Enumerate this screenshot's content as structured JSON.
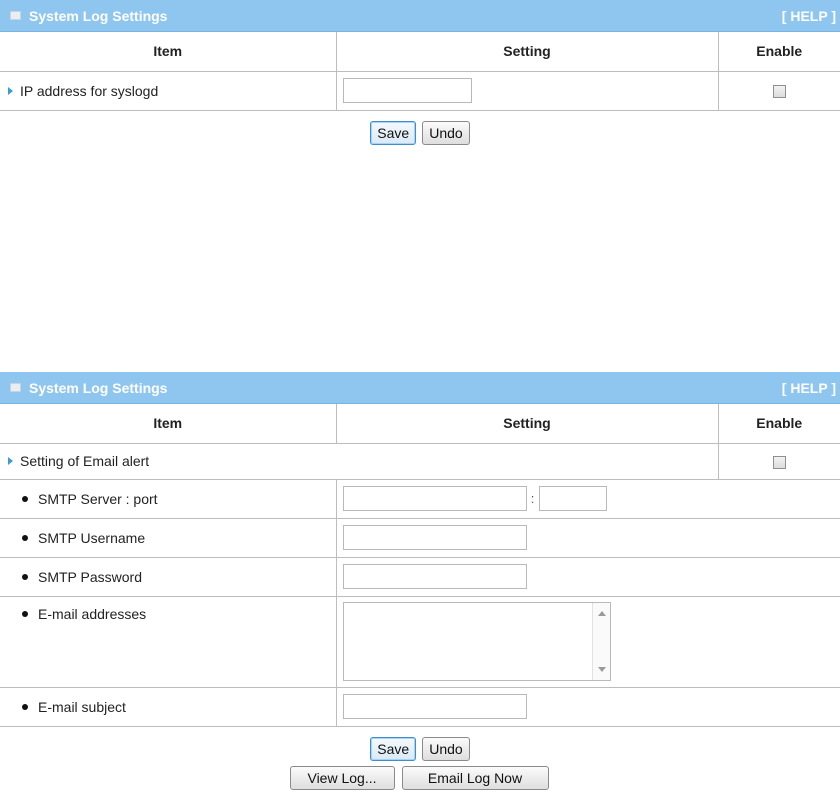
{
  "panel1": {
    "title": "System Log Settings",
    "help": "[ HELP ]",
    "columns": {
      "item": "Item",
      "setting": "Setting",
      "enable": "Enable"
    },
    "rows": [
      {
        "label": "IP address for syslogd",
        "value": "",
        "enabled": false
      }
    ],
    "buttons": {
      "save": "Save",
      "undo": "Undo"
    }
  },
  "panel2": {
    "title": "System Log Settings",
    "help": "[ HELP ]",
    "columns": {
      "item": "Item",
      "setting": "Setting",
      "enable": "Enable"
    },
    "email_alert": {
      "label": "Setting of Email alert",
      "enabled": false
    },
    "fields": {
      "smtp_server": {
        "label": "SMTP Server : port",
        "value": "",
        "port": "",
        "separator": ":"
      },
      "smtp_username": {
        "label": "SMTP Username",
        "value": ""
      },
      "smtp_password": {
        "label": "SMTP Password",
        "value": ""
      },
      "email_addresses": {
        "label": "E-mail addresses",
        "value": ""
      },
      "email_subject": {
        "label": "E-mail subject",
        "value": ""
      }
    },
    "buttons": {
      "save": "Save",
      "undo": "Undo",
      "view_log": "View Log...",
      "email_log_now": "Email Log Now"
    }
  },
  "colors": {
    "titlebar": "#8ec6ef",
    "arrow": "#3a9bd8",
    "primary_border": "#3b8fd0"
  },
  "icons": {
    "title": "window-icon",
    "row_marker": "arrow-right-icon",
    "bullet": "bullet-icon"
  }
}
